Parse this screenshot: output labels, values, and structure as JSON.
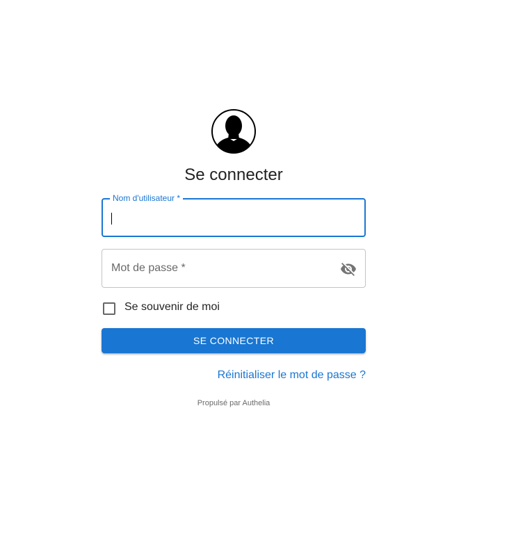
{
  "header": {
    "avatar_icon": "user-silhouette-icon",
    "title": "Se connecter"
  },
  "form": {
    "username": {
      "label": "Nom d'utilisateur *",
      "value": "",
      "state": "focused"
    },
    "password": {
      "label": "Mot de passe *",
      "value": "",
      "toggle_icon": "eye-off-icon"
    },
    "remember_me": {
      "label": "Se souvenir de moi",
      "checked": false
    },
    "submit_label": "SE CONNECTER",
    "reset_link": "Réinitialiser le mot de passe ?"
  },
  "footer": {
    "powered_by": "Propulsé par Authelia"
  },
  "colors": {
    "primary": "#1976d2",
    "text": "#212121",
    "secondary_text": "#666666",
    "border": "#c4c4c4",
    "background": "#ffffff"
  }
}
